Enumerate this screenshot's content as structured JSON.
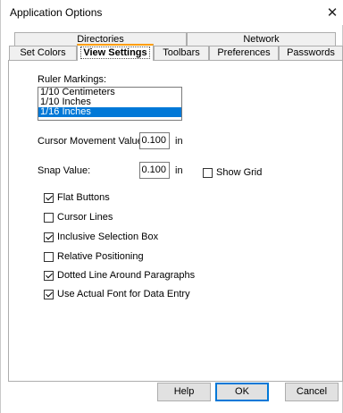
{
  "window": {
    "title": "Application Options"
  },
  "tabs": {
    "row_back": [
      {
        "label": "Directories"
      },
      {
        "label": "Network"
      }
    ],
    "row_front": [
      {
        "label": "Set Colors"
      },
      {
        "label": "View Settings"
      },
      {
        "label": "Toolbars"
      },
      {
        "label": "Preferences"
      },
      {
        "label": "Passwords"
      }
    ],
    "active": "View Settings"
  },
  "ruler": {
    "label": "Ruler Markings:",
    "options": [
      "1/10 Centimeters",
      "1/10 Inches",
      "1/16 Inches"
    ],
    "selected": "1/16 Inches"
  },
  "cursor_movement": {
    "label": "Cursor Movement Value:",
    "value": "0.100",
    "unit": "in"
  },
  "snap": {
    "label": "Snap Value:",
    "value": "0.100",
    "unit": "in"
  },
  "show_grid": {
    "label": "Show Grid",
    "checked": false
  },
  "options": [
    {
      "label": "Flat Buttons",
      "checked": true
    },
    {
      "label": "Cursor Lines",
      "checked": false
    },
    {
      "label": "Inclusive Selection Box",
      "checked": true
    },
    {
      "label": "Relative Positioning",
      "checked": false
    },
    {
      "label": "Dotted Line Around Paragraphs",
      "checked": true
    },
    {
      "label": "Use Actual Font for Data Entry",
      "checked": true
    }
  ],
  "buttons": {
    "help": "Help",
    "ok": "OK",
    "cancel": "Cancel"
  }
}
